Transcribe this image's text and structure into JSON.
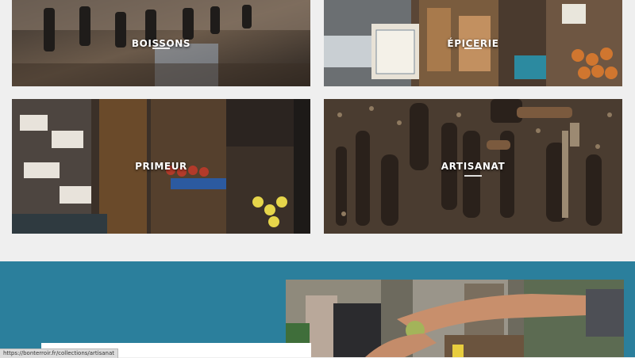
{
  "categories": [
    {
      "id": "boissons",
      "label": "BOISSONS"
    },
    {
      "id": "epicerie",
      "label": "ÉPICERIE"
    },
    {
      "id": "primeur",
      "label": "PRIMEUR"
    },
    {
      "id": "artisanat",
      "label": "ARTISANAT"
    }
  ],
  "status_bar": {
    "url": "https://bonterroir.fr/collections/artisanat"
  },
  "colors": {
    "band": "#2b7f9c",
    "page_bg": "#efefef"
  }
}
